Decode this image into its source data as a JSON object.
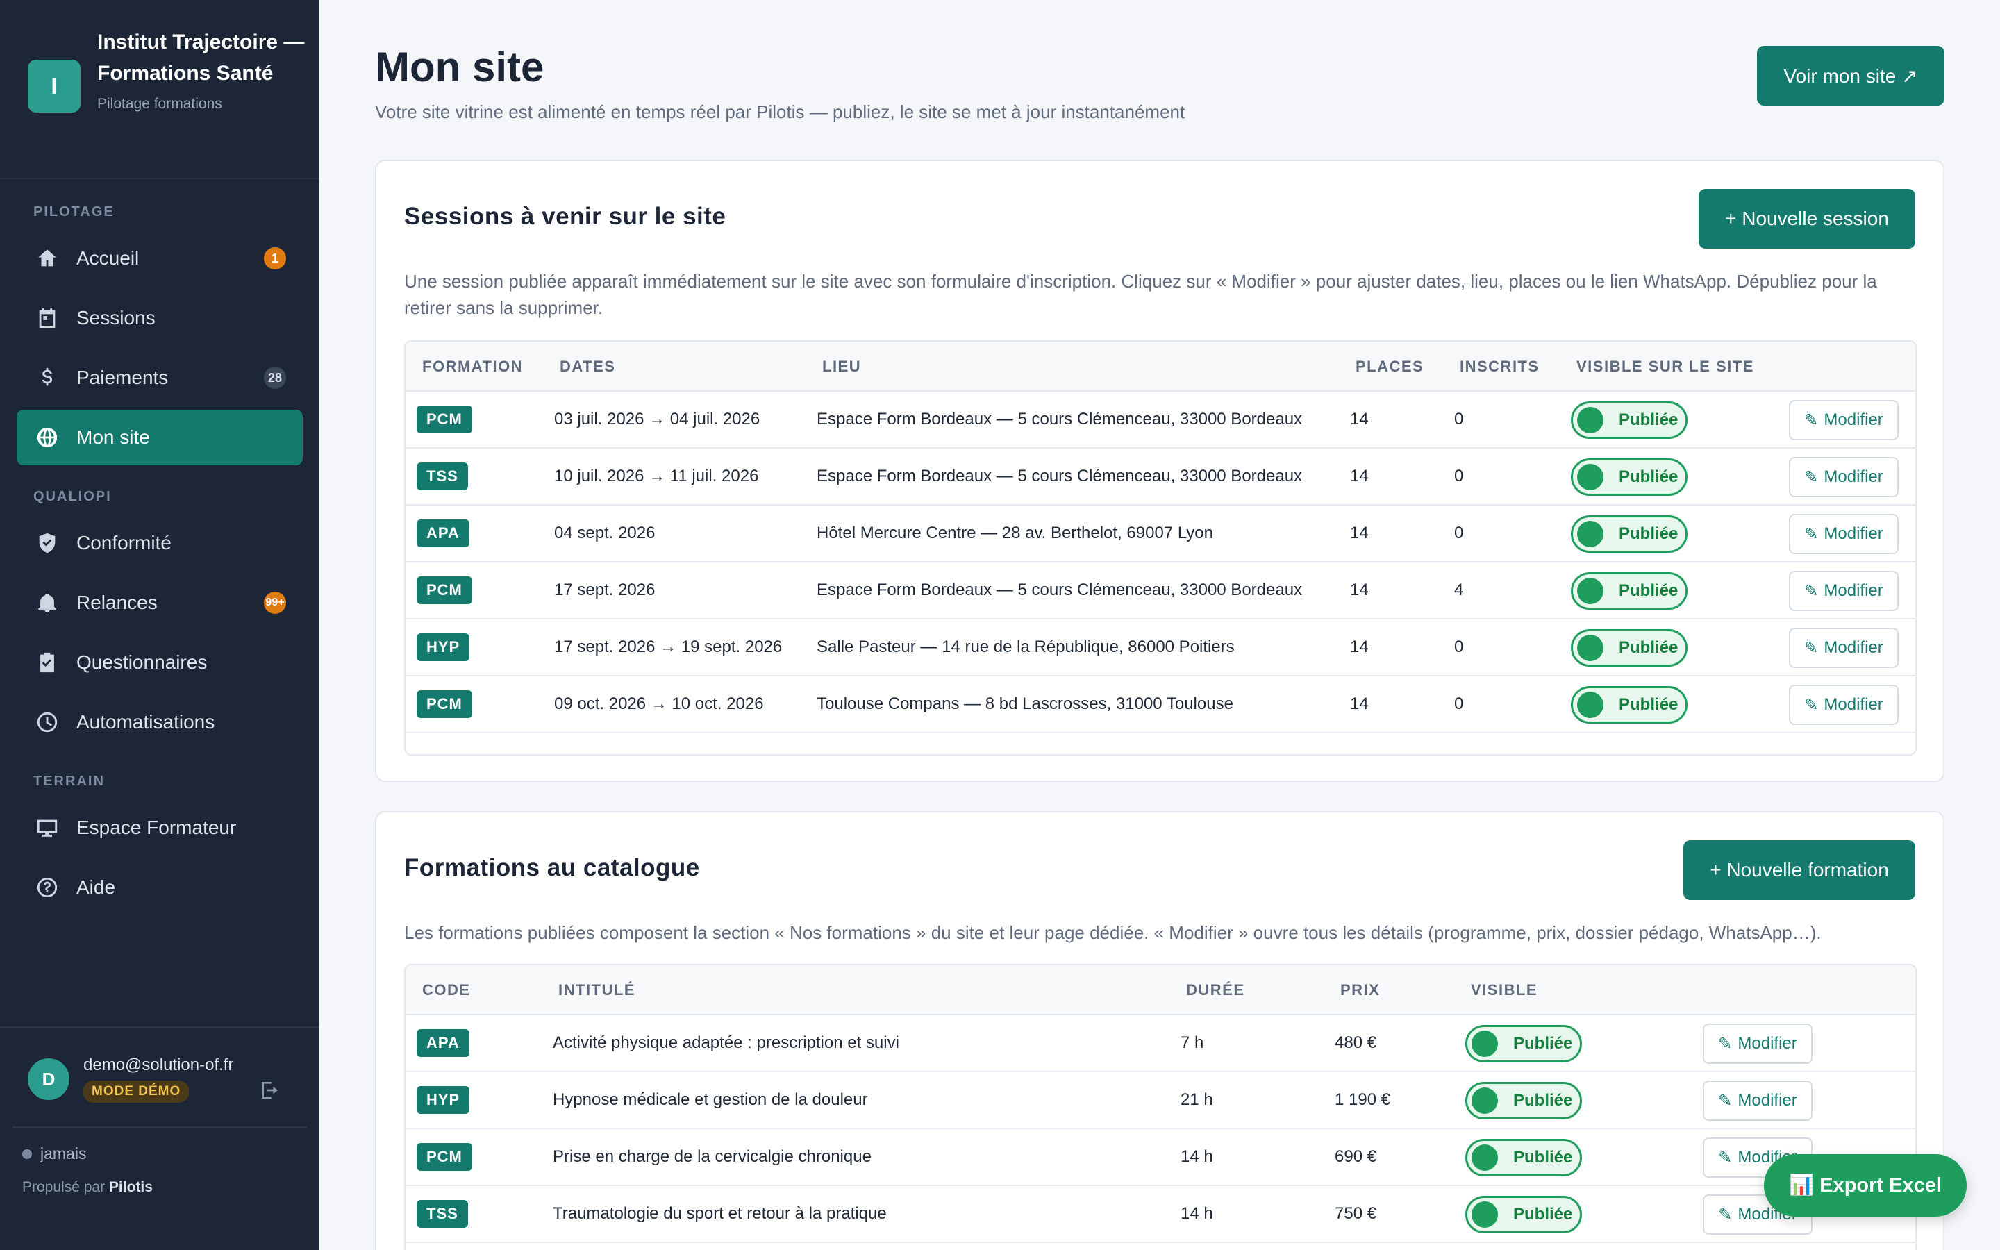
{
  "brand": {
    "logo_letter": "I",
    "name": "Institut Trajectoire — Formations Santé",
    "subtitle": "Pilotage formations"
  },
  "sidebar": {
    "sections": [
      {
        "label": "PILOTAGE"
      },
      {
        "label": "QUALIOPI"
      },
      {
        "label": "TERRAIN"
      }
    ],
    "items": [
      {
        "label": "Accueil",
        "icon": "home-icon",
        "badge": "1"
      },
      {
        "label": "Sessions",
        "icon": "calendar-icon"
      },
      {
        "label": "Paiements",
        "icon": "dollar-icon",
        "badge": "28"
      },
      {
        "label": "Mon site",
        "icon": "globe-icon",
        "active": true
      },
      {
        "label": "Conformité",
        "icon": "shield-check-icon"
      },
      {
        "label": "Relances",
        "icon": "bell-icon",
        "badge": "99+"
      },
      {
        "label": "Questionnaires",
        "icon": "clipboard-check-icon"
      },
      {
        "label": "Automatisations",
        "icon": "clock-icon"
      },
      {
        "label": "Espace Formateur",
        "icon": "monitor-icon"
      },
      {
        "label": "Aide",
        "icon": "help-circle-icon"
      }
    ]
  },
  "user": {
    "avatar_letter": "D",
    "email": "demo@solution-of.fr",
    "mode_badge": "MODE DÉMO",
    "status": "jamais",
    "powered_prefix": "Propulsé par",
    "powered_brand": "Pilotis"
  },
  "page": {
    "title": "Mon site",
    "subtitle": "Votre site vitrine est alimenté en temps réel par Pilotis — publiez, le site se met à jour instantanément",
    "view_site_button": "Voir mon site ↗"
  },
  "sessions_card": {
    "title": "Sessions à venir sur le site",
    "new_button": "+ Nouvelle session",
    "description": "Une session publiée apparaît immédiatement sur le site avec son formulaire d'inscription. Cliquez sur « Modifier » pour ajuster dates, lieu, places ou le lien WhatsApp. Dépubliez pour la retirer sans la supprimer.",
    "columns": [
      "FORMATION",
      "DATES",
      "LIEU",
      "PLACES",
      "INSCRITS",
      "VISIBLE SUR LE SITE"
    ],
    "rows": [
      {
        "code": "PCM",
        "dates": "03 juil. 2026 → 04 juil. 2026",
        "lieu": "Espace Form Bordeaux — 5 cours Clémenceau, 33000 Bordeaux",
        "places": "14",
        "inscrits": "0",
        "status": "Publiée",
        "edit": "Modifier"
      },
      {
        "code": "TSS",
        "dates": "10 juil. 2026 → 11 juil. 2026",
        "lieu": "Espace Form Bordeaux — 5 cours Clémenceau, 33000 Bordeaux",
        "places": "14",
        "inscrits": "0",
        "status": "Publiée",
        "edit": "Modifier"
      },
      {
        "code": "APA",
        "dates": "04 sept. 2026",
        "lieu": "Hôtel Mercure Centre — 28 av. Berthelot, 69007 Lyon",
        "places": "14",
        "inscrits": "0",
        "status": "Publiée",
        "edit": "Modifier"
      },
      {
        "code": "PCM",
        "dates": "17 sept. 2026",
        "lieu": "Espace Form Bordeaux — 5 cours Clémenceau, 33000 Bordeaux",
        "places": "14",
        "inscrits": "4",
        "status": "Publiée",
        "edit": "Modifier"
      },
      {
        "code": "HYP",
        "dates": "17 sept. 2026 → 19 sept. 2026",
        "lieu": "Salle Pasteur — 14 rue de la République, 86000 Poitiers",
        "places": "14",
        "inscrits": "0",
        "status": "Publiée",
        "edit": "Modifier"
      },
      {
        "code": "PCM",
        "dates": "09 oct. 2026 → 10 oct. 2026",
        "lieu": "Toulouse Compans — 8 bd Lascrosses, 31000 Toulouse",
        "places": "14",
        "inscrits": "0",
        "status": "Publiée",
        "edit": "Modifier"
      }
    ]
  },
  "catalog_card": {
    "title": "Formations au catalogue",
    "new_button": "+ Nouvelle formation",
    "description": "Les formations publiées composent la section « Nos formations » du site et leur page dédiée. « Modifier » ouvre tous les détails (programme, prix, dossier pédago, WhatsApp…).",
    "columns": [
      "CODE",
      "INTITULÉ",
      "DURÉE",
      "PRIX",
      "VISIBLE"
    ],
    "rows": [
      {
        "code": "APA",
        "title": "Activité physique adaptée : prescription et suivi",
        "duration": "7 h",
        "price": "480 €",
        "status": "Publiée",
        "edit": "Modifier"
      },
      {
        "code": "HYP",
        "title": "Hypnose médicale et gestion de la douleur",
        "duration": "21 h",
        "price": "1 190 €",
        "status": "Publiée",
        "edit": "Modifier"
      },
      {
        "code": "PCM",
        "title": "Prise en charge de la cervicalgie chronique",
        "duration": "14 h",
        "price": "690 €",
        "status": "Publiée",
        "edit": "Modifier"
      },
      {
        "code": "TSS",
        "title": "Traumatologie du sport et retour à la pratique",
        "duration": "14 h",
        "price": "750 €",
        "status": "Publiée",
        "edit": "Modifier"
      }
    ]
  },
  "export_button": "📊 Export Excel",
  "colors": {
    "sidebar_bg": "#1c2637",
    "accent": "#157a6e",
    "published_green": "#1f9d5c",
    "badge_orange": "#e07b12"
  }
}
